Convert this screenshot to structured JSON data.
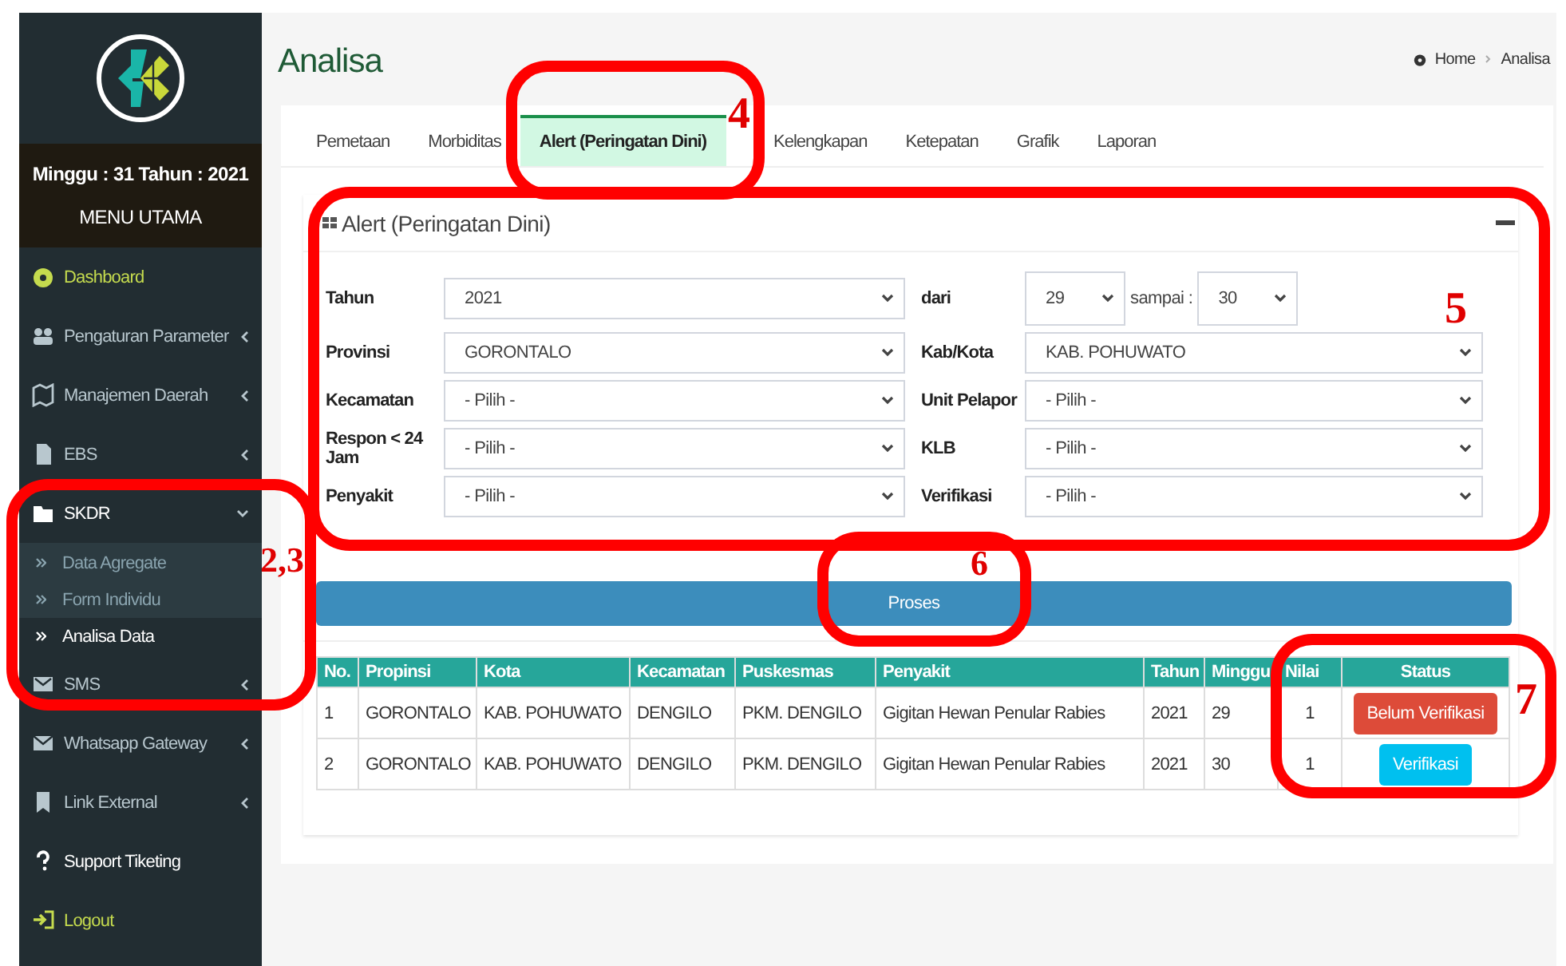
{
  "sidebar": {
    "week_info": "Minggu : 31 Tahun : 2021",
    "menu_title": "MENU UTAMA",
    "items": [
      {
        "label": "Dashboard",
        "kind": "link",
        "color": "#c5db4e"
      },
      {
        "label": "Pengaturan Parameter",
        "kind": "group",
        "expanded": false,
        "color": "#b8c7ce"
      },
      {
        "label": "Manajemen Daerah",
        "kind": "group",
        "expanded": false,
        "color": "#b8c7ce"
      },
      {
        "label": "EBS",
        "kind": "group",
        "expanded": false,
        "color": "#b8c7ce"
      },
      {
        "label": "SKDR",
        "kind": "group",
        "expanded": true,
        "color": "#ffffff",
        "children": [
          {
            "label": "Data Agregate",
            "selected": false
          },
          {
            "label": "Form Individu",
            "selected": false
          },
          {
            "label": "Analisa Data",
            "selected": true
          }
        ]
      },
      {
        "label": "SMS",
        "kind": "group",
        "expanded": false,
        "color": "#b8c7ce"
      },
      {
        "label": "Whatsapp Gateway",
        "kind": "group",
        "expanded": false,
        "color": "#b8c7ce"
      },
      {
        "label": "Link External",
        "kind": "group",
        "expanded": false,
        "color": "#b8c7ce"
      },
      {
        "label": "Support Tiketing",
        "kind": "link",
        "color": "#ffffff"
      },
      {
        "label": "Logout",
        "kind": "link",
        "color": "#c5db4e"
      }
    ]
  },
  "page": {
    "title": "Analisa",
    "breadcrumb": [
      "Home",
      "Analisa"
    ]
  },
  "tabs": [
    {
      "label": "Pemetaan",
      "selected": false
    },
    {
      "label": "Morbiditas",
      "selected": false
    },
    {
      "label": "Alert (Peringatan Dini)",
      "selected": true
    },
    {
      "label": "Kelengkapan",
      "selected": false
    },
    {
      "label": "Ketepatan",
      "selected": false
    },
    {
      "label": "Grafik",
      "selected": false
    },
    {
      "label": "Laporan",
      "selected": false
    }
  ],
  "panel": {
    "title": "Alert (Peringatan Dini)",
    "fields": [
      {
        "kind": "select",
        "label": "Tahun",
        "value": "2021"
      },
      {
        "kind": "range",
        "label": "dari",
        "from": "29",
        "separator": "sampai :",
        "to": "30"
      },
      {
        "kind": "select",
        "label": "Provinsi",
        "value": "GORONTALO"
      },
      {
        "kind": "select",
        "label": "Kab/Kota",
        "value": "KAB. POHUWATO"
      },
      {
        "kind": "select",
        "label": "Kecamatan",
        "value": "- Pilih -"
      },
      {
        "kind": "select",
        "label": "Unit Pelapor",
        "value": "- Pilih -"
      },
      {
        "kind": "select",
        "label": "Respon < 24 Jam",
        "value": "- Pilih -"
      },
      {
        "kind": "select",
        "label": "KLB",
        "value": "- Pilih -"
      },
      {
        "kind": "select",
        "label": "Penyakit",
        "value": "- Pilih -"
      },
      {
        "kind": "select",
        "label": "Verifikasi",
        "value": "- Pilih -"
      }
    ],
    "submit": "Proses",
    "table": {
      "columns": [
        "No.",
        "Propinsi",
        "Kota",
        "Kecamatan",
        "Puskesmas",
        "Penyakit",
        "Tahun",
        "Minggu",
        "Nilai",
        "Status"
      ],
      "rows": [
        {
          "cells": [
            "1",
            "GORONTALO",
            "KAB. POHUWATO",
            "DENGILO",
            "PKM. DENGILO",
            "Gigitan Hewan Penular Rabies",
            "2021",
            "29",
            "1"
          ],
          "status": {
            "label": "Belum Verifikasi",
            "kind": "danger"
          }
        },
        {
          "cells": [
            "2",
            "GORONTALO",
            "KAB. POHUWATO",
            "DENGILO",
            "PKM. DENGILO",
            "Gigitan Hewan Penular Rabies",
            "2021",
            "30",
            "1"
          ],
          "status": {
            "label": "Verifikasi",
            "kind": "info"
          }
        }
      ]
    }
  },
  "annotations": [
    {
      "label": "4"
    },
    {
      "label": "5"
    },
    {
      "label": "2,3"
    },
    {
      "label": "6"
    },
    {
      "label": "7"
    }
  ]
}
